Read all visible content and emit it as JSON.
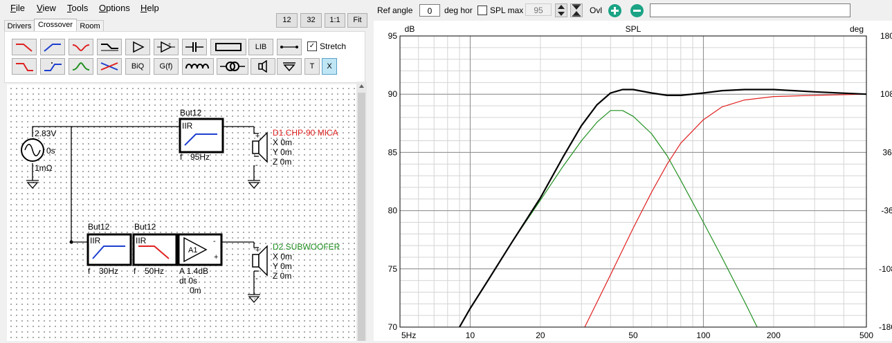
{
  "menu": {
    "file": "File",
    "view": "View",
    "tools": "Tools",
    "options": "Options",
    "help": "Help"
  },
  "zoom": {
    "z12": "12",
    "z32": "32",
    "z11": "1:1",
    "fit": "Fit"
  },
  "tabs": {
    "drivers": "Drivers",
    "crossover": "Crossover",
    "room": "Room"
  },
  "toolbar": {
    "lib": "LIB",
    "biq": "BiQ",
    "gf": "G(f)",
    "t": "T",
    "x": "X",
    "stretch": "Stretch",
    "stretch_checked": "✓"
  },
  "schematic": {
    "source": {
      "voltage": "2.83V",
      "delay": "0s",
      "impedance": "1mΩ"
    },
    "filter_top": {
      "type": "But12",
      "mode": "IIR",
      "freq_label": "f",
      "freq": "95Hz"
    },
    "driver1": {
      "name": "D1.CHP-90 MICA",
      "x": "X 0m",
      "y": "Y 0m",
      "z": "Z 0m",
      "plus": "+",
      "minus": "-"
    },
    "filter_b1": {
      "type": "But12",
      "mode": "IIR",
      "freq_label": "f",
      "freq": "30Hz"
    },
    "filter_b2": {
      "type": "But12",
      "mode": "IIR",
      "freq_label": "f",
      "freq": "50Hz"
    },
    "amp": {
      "name": "A1",
      "gain": "A  1.4dB",
      "delay": "dt 0s",
      "dist": "0m",
      "minus": "-",
      "plus": "+"
    },
    "driver2": {
      "name": "D2.SUBWOOFER",
      "x": "X 0m",
      "y": "Y 0m",
      "z": "Z 0m",
      "plus": "+",
      "minus": "-"
    }
  },
  "right_toolbar": {
    "ref_angle_label": "Ref angle",
    "ref_angle_value": "0",
    "deg_hor": "deg hor",
    "spl_max_label": "SPL max",
    "spl_max_value": "95",
    "ovl": "Ovl",
    "text_field": ""
  },
  "colors": {
    "red": "#e02020",
    "green": "#1f8f1f",
    "blue": "#1c3fd0",
    "black": "#000000",
    "grid": "#d4d4d4",
    "grid_major": "#8c8c8c"
  },
  "chart_data": {
    "type": "line",
    "title": "SPL",
    "ylabel_left": "dB",
    "ylabel_right": "deg",
    "x_scale": "log",
    "xlim": [
      5,
      500
    ],
    "ylim": [
      70,
      95
    ],
    "y2lim": [
      -180,
      180
    ],
    "x_tick_labels": [
      "5Hz",
      "10",
      "20",
      "50",
      "100",
      "200",
      "500"
    ],
    "x_tick_values": [
      5,
      10,
      20,
      50,
      100,
      200,
      500
    ],
    "y_ticks": [
      95,
      90,
      85,
      80,
      75,
      70
    ],
    "y2_ticks": [
      180,
      108,
      36,
      -36,
      -108,
      -180
    ],
    "grid": true,
    "series": [
      {
        "color": "green",
        "x": [
          9,
          10,
          12,
          15,
          20,
          25,
          30,
          35,
          40,
          45,
          50,
          60,
          70,
          80,
          100,
          120,
          150,
          170
        ],
        "y": [
          70,
          71.6,
          74.1,
          77.2,
          80.9,
          83.8,
          86.0,
          87.6,
          88.6,
          88.6,
          88.1,
          86.6,
          84.7,
          82.6,
          79.0,
          76.0,
          72.2,
          70
        ]
      },
      {
        "color": "red",
        "x": [
          31,
          40,
          50,
          60,
          70,
          80,
          100,
          120,
          150,
          200,
          300,
          500
        ],
        "y": [
          70,
          74.5,
          78.5,
          81.6,
          84.0,
          85.8,
          87.8,
          88.9,
          89.5,
          89.8,
          89.9,
          90.0
        ]
      },
      {
        "color": "black",
        "x": [
          9,
          10,
          12,
          15,
          20,
          25,
          30,
          35,
          40,
          45,
          50,
          60,
          70,
          80,
          100,
          120,
          150,
          200,
          300,
          500
        ],
        "y": [
          70,
          71.6,
          74.1,
          77.2,
          81.1,
          84.6,
          87.3,
          89.1,
          90.1,
          90.4,
          90.4,
          90.1,
          89.9,
          89.9,
          90.1,
          90.3,
          90.4,
          90.4,
          90.2,
          90.0
        ]
      }
    ]
  }
}
